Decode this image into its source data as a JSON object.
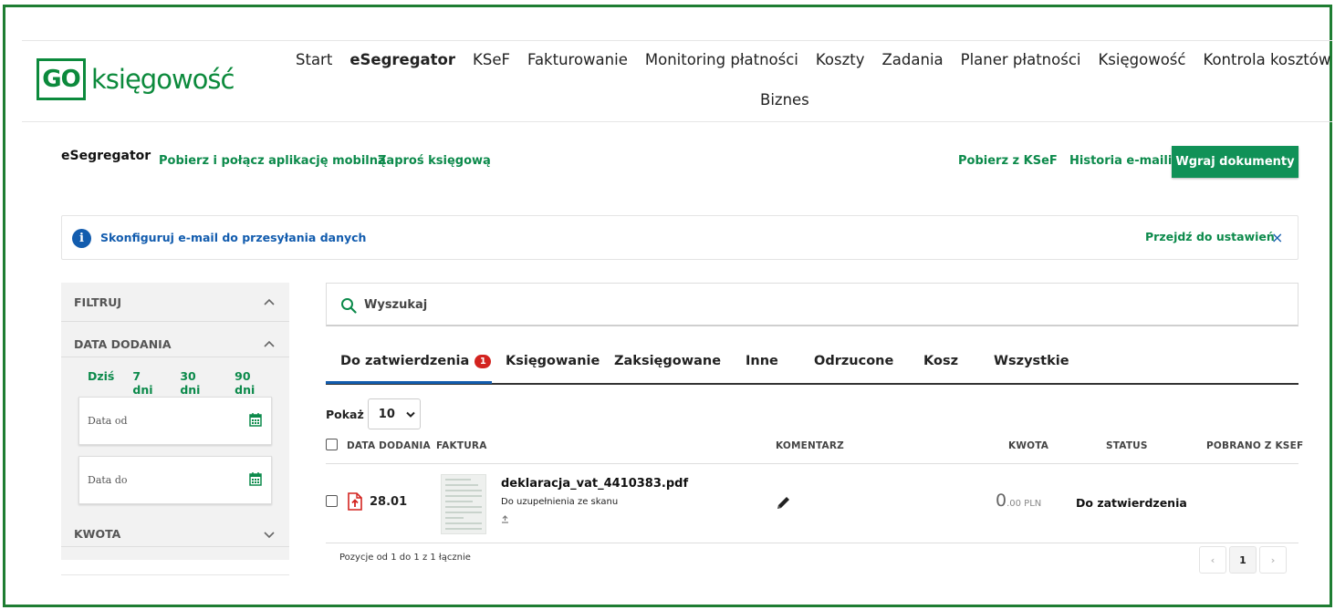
{
  "logo": {
    "go": "GO",
    "word": "księgowość"
  },
  "nav": {
    "items": [
      "Start",
      "eSegregator",
      "KSeF",
      "Fakturowanie",
      "Monitoring płatności",
      "Koszty",
      "Zadania",
      "Planer płatności",
      "Księgowość",
      "Kontrola kosztów"
    ],
    "second_row": "Biznes",
    "active": "eSegregator"
  },
  "subheader": {
    "title": "eSegregator",
    "link_mobile": "Pobierz i połącz aplikację mobilną",
    "link_invite": "Zaproś księgową",
    "link_ksef": "Pobierz z KSeF",
    "link_history": "Historia e-maili",
    "upload_button": "Wgraj dokumenty"
  },
  "banner": {
    "icon": "info-icon",
    "text": "Skonfiguruj e-mail do przesyłania danych",
    "link": "Przejdź do ustawień",
    "close": "×"
  },
  "sidebar": {
    "filter_title": "FILTRUJ",
    "date_title": "DATA DODANIA",
    "quick": [
      "Dziś",
      "7 dni",
      "30 dni",
      "90 dni"
    ],
    "date_from": "Data od",
    "date_to": "Data do",
    "amount_title": "KWOTA"
  },
  "search": {
    "placeholder": "Wyszukaj"
  },
  "tabs": {
    "items": [
      "Do zatwierdzenia",
      "Księgowanie",
      "Zaksięgowane",
      "Inne",
      "Odrzucone",
      "Kosz",
      "Wszystkie"
    ],
    "badge": "1"
  },
  "show": {
    "label": "Pokaż",
    "value": "10"
  },
  "table": {
    "headers": {
      "date": "DATA DODANIA",
      "invoice": "FAKTURA",
      "comment": "KOMENTARZ",
      "amount": "KWOTA",
      "status": "STATUS",
      "ksef": "POBRANO Z KSEF"
    },
    "rows": [
      {
        "date": "28.01",
        "filename": "deklaracja_vat_4410383.pdf",
        "subtitle": "Do uzupełnienia ze skanu",
        "amount_int": "0",
        "amount_dec": ".00 PLN",
        "status": "Do zatwierdzenia"
      }
    ]
  },
  "footer": {
    "summary": "Pozycje od 1 do 1 z 1 łącznie"
  },
  "pager": {
    "prev": "‹",
    "current": "1",
    "next": "›"
  },
  "colors": {
    "brand_green": "#0c8a3c",
    "button_green": "#109157",
    "info_blue": "#125cae",
    "badge_red": "#d3231f",
    "frame_green": "#1e7d32"
  }
}
